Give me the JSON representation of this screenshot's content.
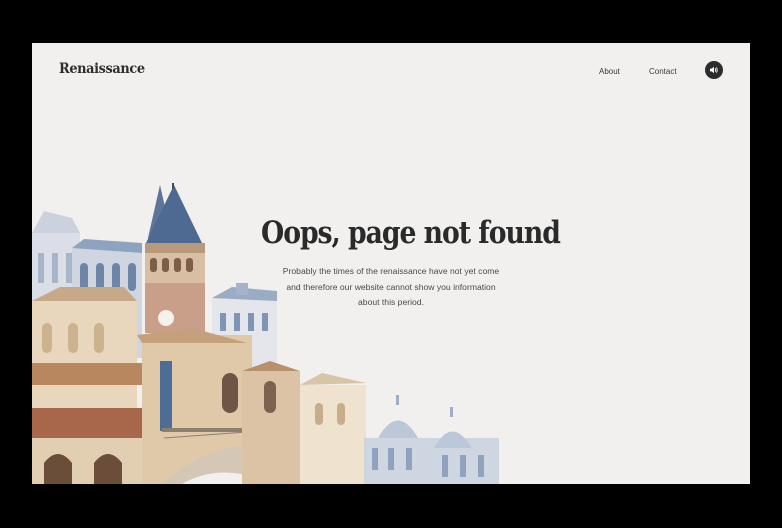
{
  "header": {
    "logo": "Renaissance",
    "nav": [
      {
        "label": "About"
      },
      {
        "label": "Contact"
      }
    ],
    "sound_icon": "speaker-icon"
  },
  "main": {
    "title": "Oops, page not found",
    "description_lines": [
      "Probably the times of the renaissance have not yet come",
      "and therefore our website cannot show you information",
      "about this period."
    ]
  },
  "illustration": "watercolor-city-buildings",
  "colors": {
    "background": "#f1f0ee",
    "outer": "#000000",
    "text": "#2a2a2a",
    "button": "#2c2c2c"
  }
}
